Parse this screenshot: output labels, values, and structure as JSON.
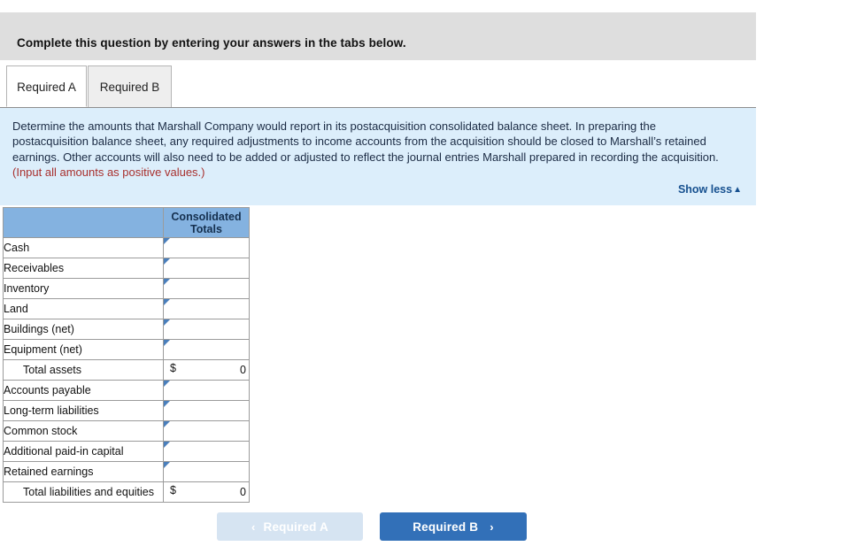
{
  "question_band": {
    "title": "Complete this question by entering your answers in the tabs below."
  },
  "tabs": [
    {
      "label": "Required A",
      "active": true
    },
    {
      "label": "Required B",
      "active": false
    }
  ],
  "info_panel": {
    "text_part1": "Determine the amounts that Marshall Company would report in its postacquisition consolidated balance sheet. In preparing the postacquisition balance sheet, any required adjustments to income accounts from the acquisition should be closed to Marshall’s retained earnings. Other accounts will also need to be added or adjusted to reflect the journal entries Marshall prepared in recording the acquisition. ",
    "text_highlight": "(Input all amounts as positive values.)",
    "show_less_label": "Show less",
    "show_less_caret": "▲",
    "highlight_color": "#a8302e",
    "link_color": "#16508f",
    "background_color": "#dceefb"
  },
  "table": {
    "header_blank": "",
    "header_value": "Consolidated Totals",
    "header_value_line1": "Consolidated",
    "header_value_line2": "Totals",
    "header_background": "#84b2e0",
    "input_border_color": "#4a7fbc",
    "rows": [
      {
        "label": "Cash",
        "type": "input",
        "value": ""
      },
      {
        "label": "Receivables",
        "type": "input",
        "value": ""
      },
      {
        "label": "Inventory",
        "type": "input",
        "value": ""
      },
      {
        "label": "Land",
        "type": "input",
        "value": ""
      },
      {
        "label": "Buildings (net)",
        "type": "input",
        "value": ""
      },
      {
        "label": "Equipment (net)",
        "type": "input",
        "value": ""
      },
      {
        "label": "Total assets",
        "type": "total",
        "currency": "$",
        "value": "0"
      },
      {
        "label": "Accounts payable",
        "type": "input",
        "value": ""
      },
      {
        "label": "Long-term liabilities",
        "type": "input",
        "value": ""
      },
      {
        "label": "Common stock",
        "type": "input",
        "value": ""
      },
      {
        "label": "Additional paid-in capital",
        "type": "input",
        "value": ""
      },
      {
        "label": "Retained earnings",
        "type": "input",
        "value": ""
      },
      {
        "label": "Total liabilities and equities",
        "type": "total",
        "currency": "$",
        "value": "0"
      }
    ]
  },
  "footer": {
    "prev_label": "Required A",
    "prev_chevron": "‹",
    "next_label": "Required B",
    "next_chevron": "›",
    "next_color": "#3270b8",
    "prev_color": "#d6e4f2"
  }
}
